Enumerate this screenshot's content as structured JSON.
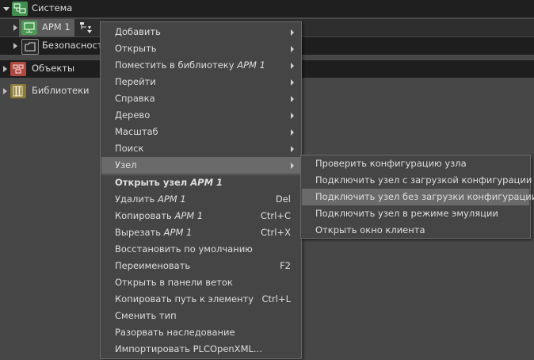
{
  "tree": {
    "sistema": "Система",
    "arm": "АРМ 1",
    "bezopasnost": "Безопасность",
    "obekty": "Объекты",
    "biblioteki": "Библиотеки"
  },
  "context_menu": {
    "items": [
      {
        "label": "Добавить",
        "submenu": true
      },
      {
        "label": "Открыть",
        "submenu": true
      },
      {
        "label": "Поместить в библиотеку",
        "suffix": "АРМ 1",
        "submenu": true
      },
      {
        "label": "Перейти",
        "submenu": true
      },
      {
        "label": "Справка",
        "submenu": true
      },
      {
        "label": "Дерево",
        "submenu": true
      },
      {
        "label": "Масштаб",
        "submenu": true
      },
      {
        "label": "Поиск",
        "submenu": true
      },
      {
        "label": "Узел",
        "submenu": true,
        "highlighted": true
      },
      {
        "label": "Открыть узел",
        "suffix": "АРМ 1",
        "bold": true
      },
      {
        "label": "Удалить",
        "suffix": "АРМ 1",
        "shortcut": "Del"
      },
      {
        "label": "Копировать",
        "suffix": "АРМ 1",
        "shortcut": "Ctrl+C"
      },
      {
        "label": "Вырезать",
        "suffix": "АРМ 1",
        "shortcut": "Ctrl+X"
      },
      {
        "label": "Восстановить по умолчанию"
      },
      {
        "label": "Переименовать",
        "shortcut": "F2"
      },
      {
        "label": "Открыть в панели веток"
      },
      {
        "label": "Копировать путь к элементу",
        "shortcut": "Ctrl+L"
      },
      {
        "label": "Сменить тип"
      },
      {
        "label": "Разорвать наследование"
      },
      {
        "label": "Импортировать PLCOpenXML..."
      }
    ]
  },
  "submenu_uzel": {
    "items": [
      {
        "label": "Проверить конфигурацию узла"
      },
      {
        "label": "Подключить узел с загрузкой конфигурации"
      },
      {
        "label": "Подключить узел без загрузки конфигурации",
        "highlighted": true
      },
      {
        "label": "Подключить узел в режиме эмуляции"
      },
      {
        "label": "Открыть окно клиента"
      }
    ]
  },
  "colors": {
    "background": "#474747",
    "tree_bar": "#1e1e1e",
    "menu_bg": "#454545",
    "menu_highlight": "#6a6a6a",
    "icon_green": "#4a9a52",
    "icon_red": "#b04a40",
    "icon_olive": "#8a7a38"
  },
  "icons": {
    "sistema": "network-nodes-icon",
    "arm": "workstation-icon",
    "bezopasnost": "security-folder-icon",
    "obekty": "objects-icon",
    "biblioteki": "library-icon",
    "arm_action": "hierarchy-action-icon"
  }
}
